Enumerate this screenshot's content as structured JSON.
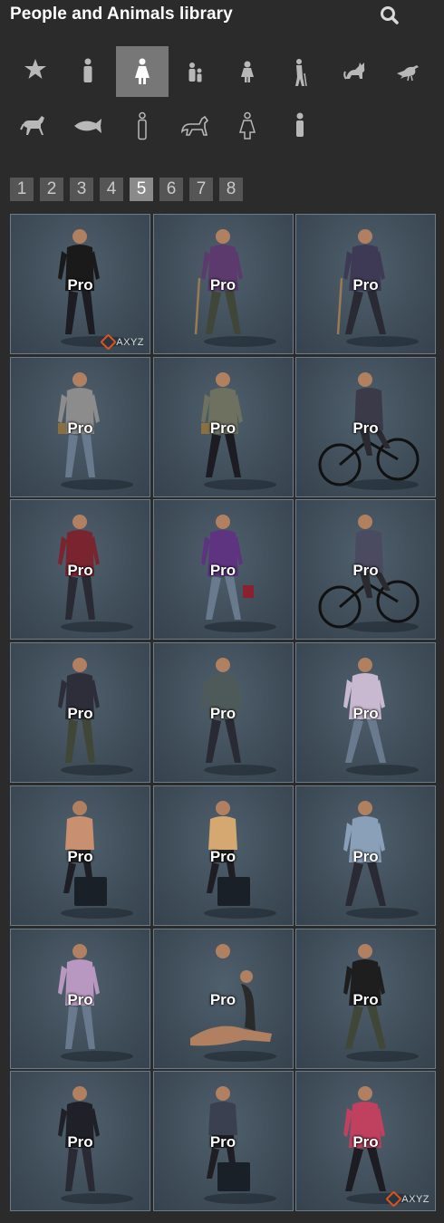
{
  "header": {
    "title": "People and Animals library",
    "search_icon": "search-icon"
  },
  "categories": [
    {
      "icon": "star-icon",
      "active": false
    },
    {
      "icon": "person-icon",
      "active": false
    },
    {
      "icon": "woman-icon",
      "active": true
    },
    {
      "icon": "child-icon",
      "active": false
    },
    {
      "icon": "girl-icon",
      "active": false
    },
    {
      "icon": "elderly-icon",
      "active": false
    },
    {
      "icon": "cat-icon",
      "active": false
    },
    {
      "icon": "bird-icon",
      "active": false
    },
    {
      "icon": "horse-icon",
      "active": false
    },
    {
      "icon": "fish-icon",
      "active": false
    },
    {
      "icon": "man-outline-icon",
      "active": false
    },
    {
      "icon": "dog-icon",
      "active": false
    },
    {
      "icon": "woman-outline-icon",
      "active": false
    },
    {
      "icon": "person-small-icon",
      "active": false
    }
  ],
  "pagination": {
    "pages": [
      "1",
      "2",
      "3",
      "4",
      "5",
      "6",
      "7",
      "8"
    ],
    "active": "5"
  },
  "tiles": [
    {
      "badge": "Pro",
      "watermark": "AXYZ"
    },
    {
      "badge": "Pro"
    },
    {
      "badge": "Pro"
    },
    {
      "badge": "Pro"
    },
    {
      "badge": "Pro"
    },
    {
      "badge": "Pro"
    },
    {
      "badge": "Pro"
    },
    {
      "badge": "Pro"
    },
    {
      "badge": "Pro"
    },
    {
      "badge": "Pro"
    },
    {
      "badge": "Pro"
    },
    {
      "badge": "Pro"
    },
    {
      "badge": "Pro"
    },
    {
      "badge": "Pro"
    },
    {
      "badge": "Pro"
    },
    {
      "badge": "Pro"
    },
    {
      "badge": "Pro"
    },
    {
      "badge": "Pro"
    },
    {
      "badge": "Pro"
    },
    {
      "badge": "Pro"
    },
    {
      "badge": "Pro",
      "watermark": "AXYZ"
    }
  ]
}
